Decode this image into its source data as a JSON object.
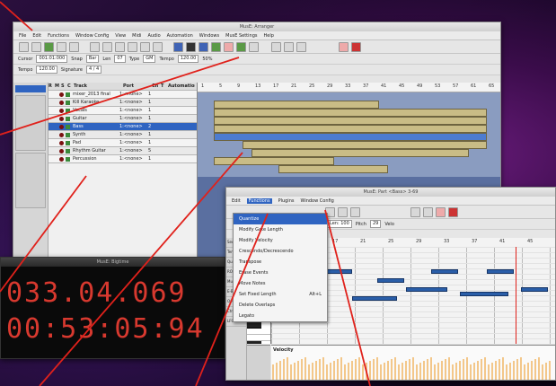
{
  "arranger": {
    "title": "MusE: Arranger",
    "menus": [
      "File",
      "Edit",
      "Functions",
      "Window Config",
      "View",
      "Midi",
      "Audio",
      "Automation",
      "Windows",
      "MusE Settings",
      "Help"
    ],
    "cursor_label": "Cursor",
    "cursor_value": "001:01:000",
    "snap_label": "Snap",
    "snap_value": "Bar",
    "len_label": "Len",
    "len_value": "07",
    "type_label": "Type",
    "type_value": "GM",
    "tempo_label": "Tempo",
    "tempo_value": "120.00",
    "pct_label": "50%",
    "signature_label": "Signature",
    "signature_value": "4 / 4",
    "track_header": [
      "R",
      "M",
      "S",
      "C",
      "Track",
      "Port",
      "Ch",
      "T",
      "Automation"
    ],
    "tracks": [
      "mixer_2013 final",
      "Kill Karaoke",
      "Vocals",
      "Guitar",
      "Bass",
      "Synth",
      "Pad",
      "Rhythm Guitar",
      "Percussion"
    ],
    "track_ports": [
      "1:<none>",
      "1:<none>",
      "1:<none>",
      "1:<none>",
      "1:<none>",
      "1:<none>",
      "1:<none>",
      "1:<none>",
      "1:<none>"
    ],
    "track_channels": [
      "1",
      "1",
      "1",
      "1",
      "2",
      "1",
      "1",
      "5",
      "1"
    ],
    "ruler_bars": [
      "1",
      "5",
      "9",
      "13",
      "17",
      "21",
      "25",
      "29",
      "33",
      "37",
      "41",
      "45",
      "49",
      "53",
      "57",
      "61",
      "65"
    ]
  },
  "bigtime": {
    "title": "MusE: Bigtime",
    "bbt": "033.04.069",
    "time": "00:53:05:94"
  },
  "pianoroll": {
    "title": "MusE: Part <Bass> 3-69",
    "menus": [
      "Edit",
      "Functions",
      "Plugins",
      "Window Config"
    ],
    "info": "Len: 100",
    "pitch_label": "Pitch",
    "pitch_value": "29",
    "velo_label": "Velo",
    "ruler_bars": [
      "9",
      "13",
      "17",
      "21",
      "25",
      "29",
      "33",
      "37",
      "41",
      "45"
    ],
    "velocity_label": "Velocity",
    "left_panel": [
      "Sect",
      "Tempo",
      "Quant",
      "ROH",
      "Multi",
      "E-Bas",
      "Overdub",
      "Ctrl",
      "LFO"
    ]
  },
  "functions_menu": {
    "items": [
      "Quantize",
      "Modify Gate Length",
      "Modify Velocity",
      "Crescendo/Decrescendo",
      "Transpose",
      "Erase Events",
      "Move Notes",
      "Set Fixed Length",
      "Delete Overlaps",
      "Legato"
    ],
    "shortcuts": {
      "Set Fixed Length": "Alt+L"
    }
  }
}
